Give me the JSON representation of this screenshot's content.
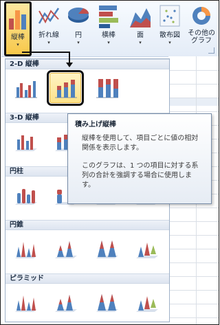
{
  "ribbon": {
    "buttons": [
      {
        "id": "column",
        "label": "縦棒",
        "icon": "column-chart-icon",
        "dropdown": "▾",
        "selected": true
      },
      {
        "id": "line",
        "label": "折れ線",
        "icon": "line-chart-icon",
        "dropdown": "▾"
      },
      {
        "id": "pie",
        "label": "円",
        "icon": "pie-chart-icon",
        "dropdown": "▾"
      },
      {
        "id": "bar",
        "label": "横棒",
        "icon": "bar-chart-icon",
        "dropdown": "▾"
      },
      {
        "id": "area",
        "label": "面",
        "icon": "area-chart-icon",
        "dropdown": "▾"
      },
      {
        "id": "scatter",
        "label": "散布図",
        "icon": "scatter-chart-icon",
        "dropdown": "▾"
      },
      {
        "id": "other",
        "label": "その他の\nグラフ",
        "icon": "doughnut-chart-icon",
        "dropdown": "▾"
      }
    ]
  },
  "gallery": {
    "sections": [
      {
        "title": "2-D 縦棒",
        "items": [
          "clustered-column-icon",
          "stacked-column-icon",
          "100-stacked-column-icon"
        ]
      },
      {
        "title": "3-D 縦棒",
        "items": [
          "3d-clustered-column-icon",
          "3d-stacked-column-icon",
          "3d-100-stacked-column-icon",
          "3d-column-icon"
        ]
      },
      {
        "title": "円柱",
        "items": [
          "cylinder-clustered-icon",
          "cylinder-stacked-icon",
          "cylinder-100-stacked-icon",
          "cylinder-3d-icon"
        ]
      },
      {
        "title": "円錐",
        "items": [
          "cone-clustered-icon",
          "cone-stacked-icon",
          "cone-100-stacked-icon",
          "cone-3d-icon"
        ]
      },
      {
        "title": "ピラミッド",
        "items": [
          "pyramid-clustered-icon",
          "pyramid-stacked-icon",
          "pyramid-100-stacked-icon",
          "pyramid-3d-icon"
        ]
      }
    ]
  },
  "tooltip": {
    "title": "積み上げ縦棒",
    "body1": "縦棒を使用して、項目ごとに値の相対関係を表示します。",
    "body2": "このグラフは、1 つの項目に対する系列の合計を強調する場合に使用します。"
  },
  "colors": {
    "accent": "#f7c84a",
    "blue": "#4f81bd",
    "red": "#c0504d",
    "green": "#9bbb59",
    "purple": "#8064a2",
    "orange": "#f79646",
    "border": "#9fb1c8"
  }
}
